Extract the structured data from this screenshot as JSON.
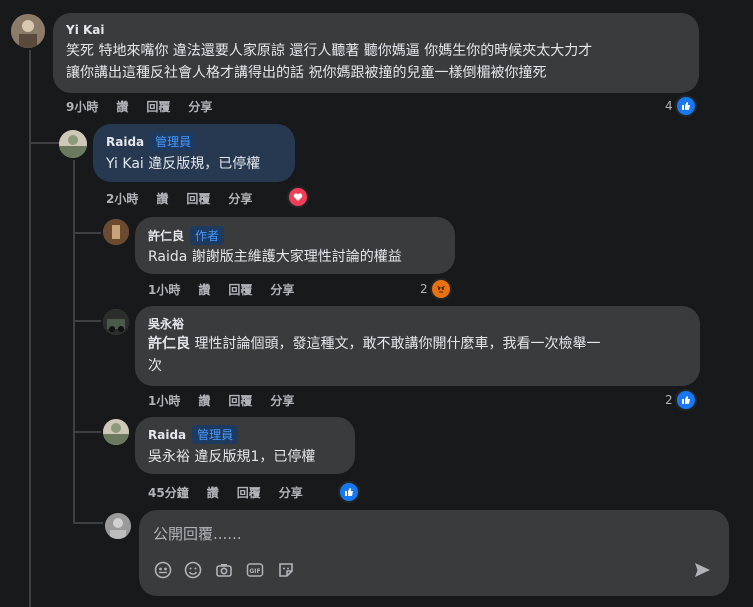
{
  "comments": [
    {
      "author": "Yi Kai",
      "line1": "笑死 特地來嘴你 違法還要人家原諒 還行人聽著 聽你媽逼 你媽生你的時候夾太大力才",
      "line2": "讓你講出這種反社會人格才講得出的話 祝你媽跟被撞的兒童一樣倒楣被你撞死",
      "time": "9小時",
      "like_label": "讚",
      "reply_label": "回覆",
      "share_label": "分享",
      "reaction_count": "4"
    },
    {
      "author": "Raida",
      "badge": "管理員",
      "text": "Yi Kai 違反版規，已停權",
      "time": "2小時",
      "like_label": "讚",
      "reply_label": "回覆",
      "share_label": "分享"
    },
    {
      "author": "許仁良",
      "badge": "作者",
      "mention": "Raida",
      "text": " 謝謝版主維護大家理性討論的權益",
      "time": "1小時",
      "like_label": "讚",
      "reply_label": "回覆",
      "share_label": "分享",
      "reaction_count": "2"
    },
    {
      "author": "吳永裕",
      "mention": "許仁良",
      "line1": " 理性討論個頭，發這種文，敢不敢講你開什麼車，我看一次檢舉一",
      "line2": "次",
      "time": "1小時",
      "like_label": "讚",
      "reply_label": "回覆",
      "share_label": "分享",
      "reaction_count": "2"
    },
    {
      "author": "Raida",
      "badge": "管理員",
      "text": "吳永裕 違反版規1，已停權",
      "time": "45分鐘",
      "like_label": "讚",
      "reply_label": "回覆",
      "share_label": "分享"
    }
  ],
  "reply": {
    "placeholder": "公開回覆......"
  },
  "colors": {
    "like": "#1877f2",
    "love": "#f33e58",
    "angry": "#e9710f",
    "admin_badge": "#4599ff"
  }
}
